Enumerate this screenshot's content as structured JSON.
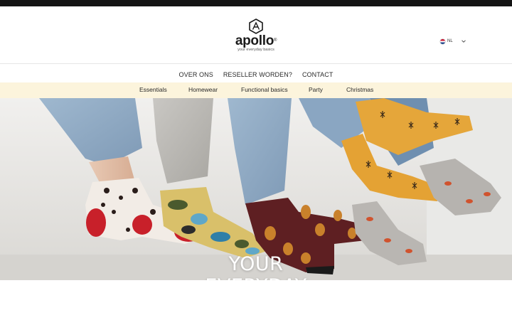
{
  "brand": {
    "name": "apollo",
    "registered": "®",
    "tagline": "your everyday basics"
  },
  "language": {
    "code": "NL",
    "flag_icon": "netherlands-flag-icon",
    "dropdown_icon": "chevron-down-icon"
  },
  "main_nav": [
    {
      "label": "OVER ONS"
    },
    {
      "label": "RESELLER WORDEN?"
    },
    {
      "label": "CONTACT"
    }
  ],
  "category_nav": [
    {
      "label": "Essentials"
    },
    {
      "label": "Homewear"
    },
    {
      "label": "Functional basics"
    },
    {
      "label": "Party"
    },
    {
      "label": "Christmas"
    }
  ],
  "hero": {
    "title": "YOUR\nEVERYDAY\nBASICS",
    "image": "people-sitting-wearing-colorful-patterned-socks"
  },
  "colors": {
    "topbar": "#141414",
    "category_bar": "#fcf4dc",
    "hero_text": "#ffffff"
  }
}
